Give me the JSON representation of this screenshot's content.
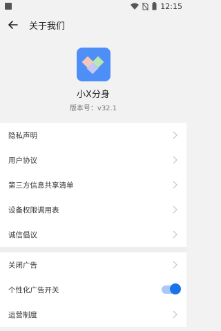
{
  "status": {
    "time": "12:15"
  },
  "appbar": {
    "title": "关于我们"
  },
  "header": {
    "app_name": "小X分身",
    "version": "版本号：v32.1"
  },
  "section1": [
    {
      "label": "隐私声明"
    },
    {
      "label": "用户协议"
    },
    {
      "label": "第三方信息共享清单"
    },
    {
      "label": "设备权限调用表"
    },
    {
      "label": "诚信倡议"
    }
  ],
  "section2": [
    {
      "label": "关闭广告"
    },
    {
      "label": "个性化广告开关",
      "toggle_on": true
    },
    {
      "label": "运营制度"
    }
  ],
  "colors": {
    "accent": "#1a73e8",
    "logo_bg": "#4e8ff7"
  }
}
